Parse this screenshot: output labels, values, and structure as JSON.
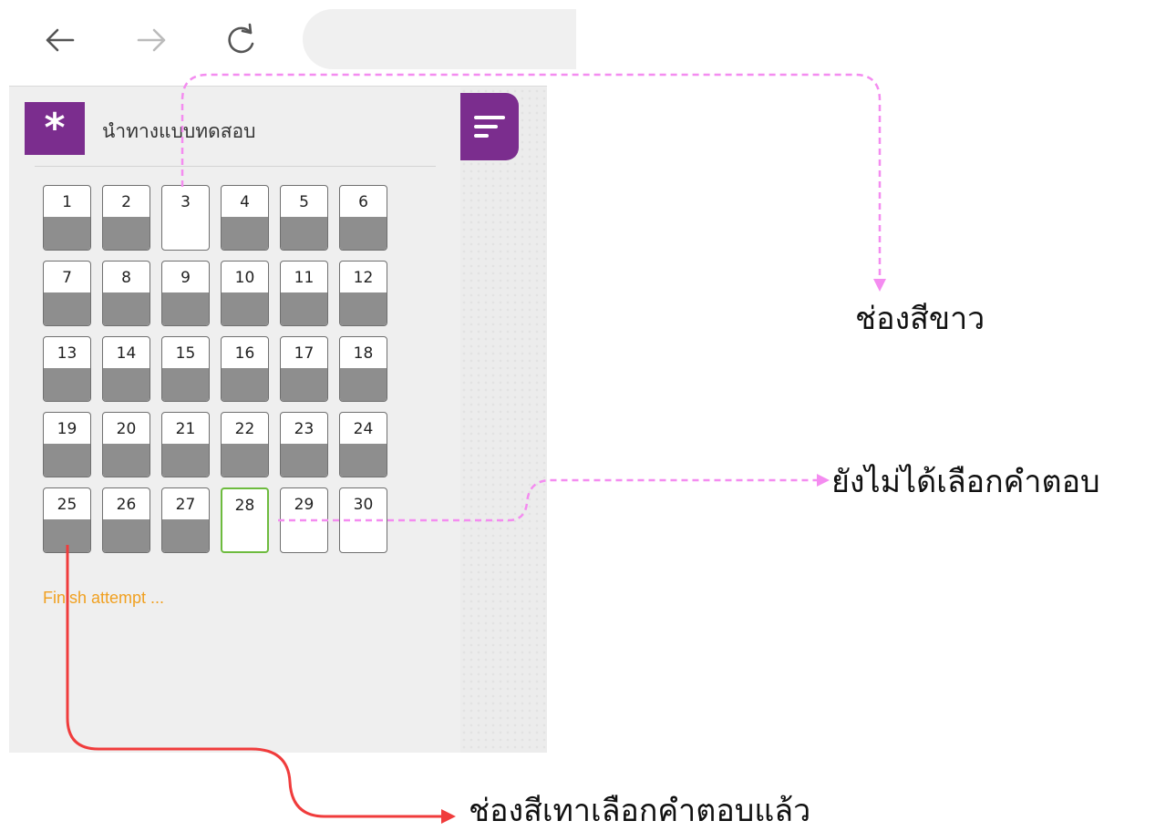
{
  "browser": {
    "back_icon": "arrow-left-icon",
    "forward_icon": "arrow-right-icon",
    "reload_icon": "reload-icon",
    "url": ""
  },
  "quiz_nav": {
    "logo_glyph": "*",
    "title": "นำทางแบบทดสอบ",
    "menu_icon": "menu-lines-icon",
    "accent_color": "#7b2d8e",
    "questions": [
      {
        "number": "1",
        "state": "answered"
      },
      {
        "number": "2",
        "state": "answered"
      },
      {
        "number": "3",
        "state": "unanswered"
      },
      {
        "number": "4",
        "state": "answered"
      },
      {
        "number": "5",
        "state": "answered"
      },
      {
        "number": "6",
        "state": "answered"
      },
      {
        "number": "7",
        "state": "answered"
      },
      {
        "number": "8",
        "state": "answered"
      },
      {
        "number": "9",
        "state": "answered"
      },
      {
        "number": "10",
        "state": "answered"
      },
      {
        "number": "11",
        "state": "answered"
      },
      {
        "number": "12",
        "state": "answered"
      },
      {
        "number": "13",
        "state": "answered"
      },
      {
        "number": "14",
        "state": "answered"
      },
      {
        "number": "15",
        "state": "answered"
      },
      {
        "number": "16",
        "state": "answered"
      },
      {
        "number": "17",
        "state": "answered"
      },
      {
        "number": "18",
        "state": "answered"
      },
      {
        "number": "19",
        "state": "answered"
      },
      {
        "number": "20",
        "state": "answered"
      },
      {
        "number": "21",
        "state": "answered"
      },
      {
        "number": "22",
        "state": "answered"
      },
      {
        "number": "23",
        "state": "answered"
      },
      {
        "number": "24",
        "state": "answered"
      },
      {
        "number": "25",
        "state": "answered"
      },
      {
        "number": "26",
        "state": "answered"
      },
      {
        "number": "27",
        "state": "answered"
      },
      {
        "number": "28",
        "state": "current"
      },
      {
        "number": "29",
        "state": "unanswered"
      },
      {
        "number": "30",
        "state": "unanswered"
      }
    ],
    "finish_label": "Finish attempt ...",
    "finish_color": "#f0a020",
    "answered_color": "#8e8e8e",
    "current_border_color": "#6dbb3e"
  },
  "annotations": {
    "white_box": "ช่องสีขาว",
    "unanswered": "ยังไม่ได้เลือกคำตอบ",
    "gray_box": "ช่องสีเทาเลือกคำตอบแล้ว",
    "pink_color": "#f48cf0",
    "red_color": "#f03c3c"
  }
}
